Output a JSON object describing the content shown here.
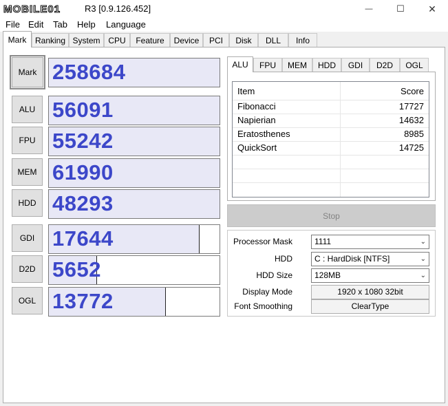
{
  "window": {
    "logo_text": "MOBILE01",
    "title": "R3 [0.9.126.452]",
    "minimize_glyph": "—",
    "maximize_glyph": "☐",
    "close_glyph": "✕"
  },
  "menu": [
    "File",
    "Edit",
    "Tab",
    "Help",
    "Language"
  ],
  "tabs": [
    "Mark",
    "Ranking",
    "System",
    "CPU",
    "Feature",
    "Device",
    "PCI",
    "Disk",
    "DLL",
    "Info"
  ],
  "active_tab": "Mark",
  "scores": [
    {
      "label": "Mark",
      "value": "258684",
      "fill": 1.0
    },
    {
      "label": "ALU",
      "value": "56091",
      "fill": 1.0
    },
    {
      "label": "FPU",
      "value": "55242",
      "fill": 1.0
    },
    {
      "label": "MEM",
      "value": "61990",
      "fill": 1.0
    },
    {
      "label": "HDD",
      "value": "48293",
      "fill": 1.0
    },
    {
      "label": "GDI",
      "value": "17644",
      "fill": 0.88
    },
    {
      "label": "D2D",
      "value": "5652",
      "fill": 0.28
    },
    {
      "label": "OGL",
      "value": "13772",
      "fill": 0.68
    }
  ],
  "sub_tabs": [
    "ALU",
    "FPU",
    "MEM",
    "HDD",
    "GDI",
    "D2D",
    "OGL"
  ],
  "active_sub_tab": "ALU",
  "table": {
    "headers": [
      "Item",
      "Score"
    ],
    "rows": [
      {
        "item": "Fibonacci",
        "score": "17727"
      },
      {
        "item": "Napierian",
        "score": "14632"
      },
      {
        "item": "Eratosthenes",
        "score": "8985"
      },
      {
        "item": "QuickSort",
        "score": "14725"
      }
    ]
  },
  "stop_label": "Stop",
  "settings": {
    "processor_mask": {
      "label": "Processor Mask",
      "value": "1111"
    },
    "hdd": {
      "label": "HDD",
      "value": "C : HardDisk [NTFS]"
    },
    "hdd_size": {
      "label": "HDD Size",
      "value": "128MB"
    },
    "display_mode": {
      "label": "Display Mode",
      "value": "1920 x 1080 32bit"
    },
    "font_smoothing": {
      "label": "Font Smoothing",
      "value": "ClearType"
    }
  }
}
